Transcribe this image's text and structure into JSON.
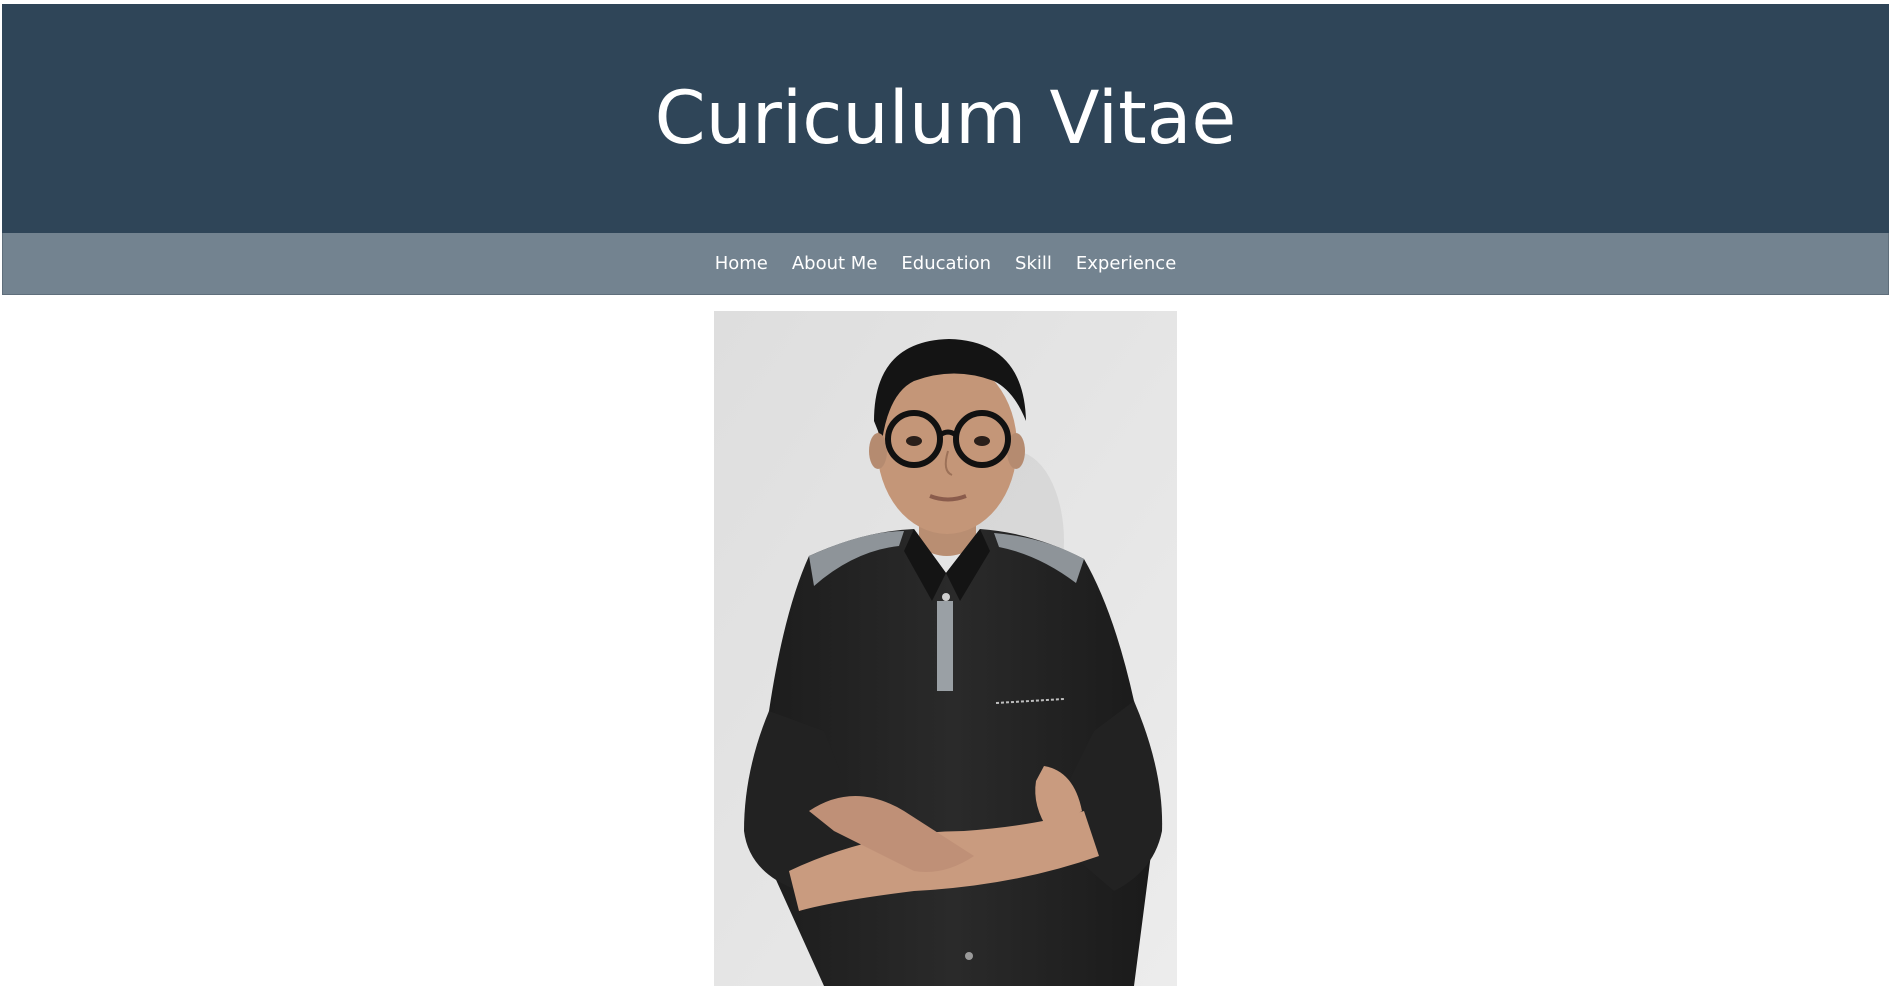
{
  "header": {
    "title": "Curiculum Vitae"
  },
  "nav": {
    "items": [
      {
        "label": "Home"
      },
      {
        "label": "About Me"
      },
      {
        "label": "Education"
      },
      {
        "label": "Skill"
      },
      {
        "label": "Experience"
      }
    ]
  },
  "colors": {
    "header_bg": "#2f4558",
    "nav_bg": "#738390",
    "page_bg": "#ffffff"
  }
}
